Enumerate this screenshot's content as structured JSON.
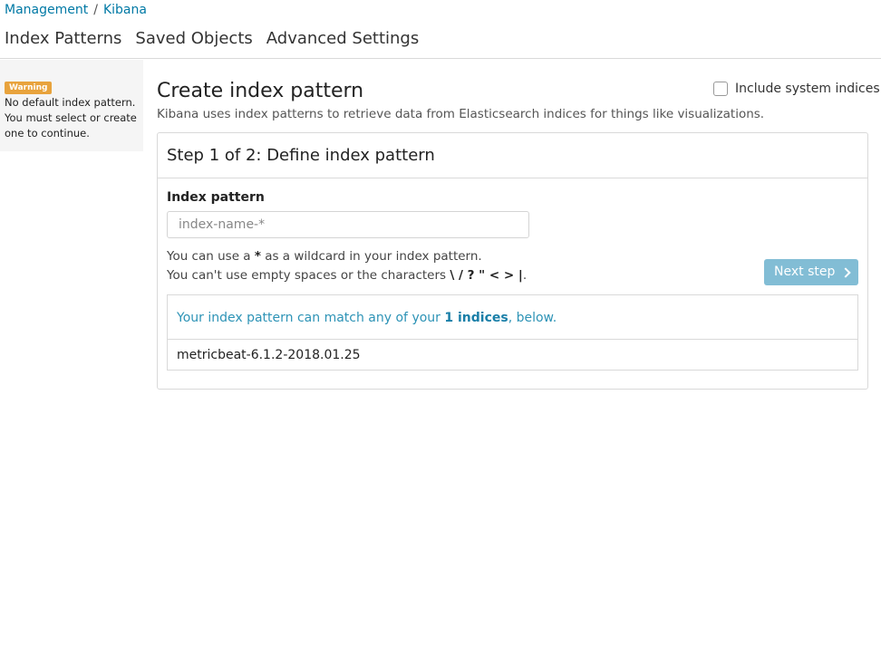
{
  "breadcrumb": {
    "items": [
      "Management",
      "Kibana"
    ],
    "separator": "/"
  },
  "nav": {
    "tabs": [
      "Index Patterns",
      "Saved Objects",
      "Advanced Settings"
    ]
  },
  "sidebar": {
    "badge": "Warning",
    "message": "No default index pattern. You must select or create one to continue."
  },
  "header": {
    "title": "Create index pattern",
    "description": "Kibana uses index patterns to retrieve data from Elasticsearch indices for things like visualizations.",
    "system_indices_label": "Include system indices",
    "system_indices_checked": false
  },
  "step": {
    "title": "Step 1 of 2: Define index pattern",
    "field_label": "Index pattern",
    "input_value": "",
    "input_placeholder": "index-name-*",
    "help_line1_prefix": "You can use a ",
    "help_line1_bold": "*",
    "help_line1_suffix": " as a wildcard in your index pattern.",
    "help_line2_prefix": "You can't use empty spaces or the characters ",
    "help_line2_bold": "\\ / ? \" < > |",
    "help_line2_suffix": ".",
    "next_button": "Next step"
  },
  "match": {
    "message_prefix": "Your index pattern can match any of your ",
    "message_bold": "1 indices",
    "message_suffix": ", below.",
    "indices": [
      "metricbeat-6.1.2-2018.01.25"
    ]
  },
  "colors": {
    "link": "#0079a5",
    "warning_badge": "#e8a33d",
    "button": "#82bdd5",
    "match_text": "#2d93b6"
  }
}
